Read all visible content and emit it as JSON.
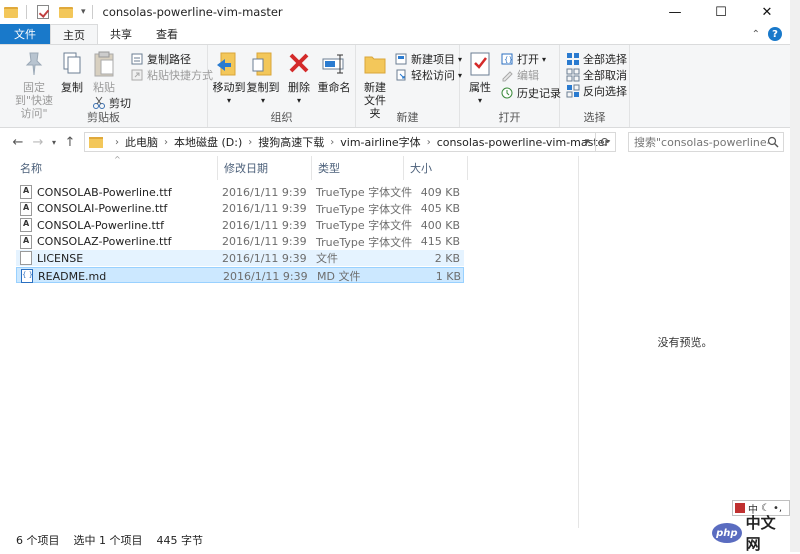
{
  "window": {
    "title": "consolas-powerline-vim-master",
    "minimize": "—",
    "maximize": "☐",
    "close": "✕"
  },
  "tabs": {
    "file": "文件",
    "home": "主页",
    "share": "共享",
    "view": "查看"
  },
  "ribbon": {
    "clipboard": {
      "label": "剪贴板",
      "pin": "固定到\"快速访问\"",
      "copy": "复制",
      "paste": "粘贴",
      "copy_path": "复制路径",
      "paste_shortcut": "粘贴快捷方式",
      "cut": "剪切"
    },
    "organize": {
      "label": "组织",
      "move_to": "移动到",
      "copy_to": "复制到",
      "delete": "删除",
      "rename": "重命名"
    },
    "new": {
      "label": "新建",
      "new_folder": "新建\n文件夹",
      "new_item": "新建项目",
      "easy_access": "轻松访问"
    },
    "open": {
      "label": "打开",
      "properties": "属性",
      "open": "打开",
      "edit": "编辑",
      "history": "历史记录"
    },
    "select": {
      "label": "选择",
      "select_all": "全部选择",
      "select_none": "全部取消",
      "invert": "反向选择"
    }
  },
  "address": {
    "crumbs": [
      "此电脑",
      "本地磁盘 (D:)",
      "搜狗高速下载",
      "vim-airline字体",
      "consolas-powerline-vim-master"
    ],
    "search_placeholder": "搜索\"consolas-powerline-vi...\""
  },
  "columns": {
    "name": "名称",
    "modified": "修改日期",
    "type": "类型",
    "size": "大小"
  },
  "files": [
    {
      "name": "CONSOLAB-Powerline.ttf",
      "modified": "2016/1/11 9:39",
      "type": "TrueType 字体文件",
      "size": "409 KB",
      "icon": "ttf"
    },
    {
      "name": "CONSOLAI-Powerline.ttf",
      "modified": "2016/1/11 9:39",
      "type": "TrueType 字体文件",
      "size": "405 KB",
      "icon": "ttf"
    },
    {
      "name": "CONSOLA-Powerline.ttf",
      "modified": "2016/1/11 9:39",
      "type": "TrueType 字体文件",
      "size": "400 KB",
      "icon": "ttf"
    },
    {
      "name": "CONSOLAZ-Powerline.ttf",
      "modified": "2016/1/11 9:39",
      "type": "TrueType 字体文件",
      "size": "415 KB",
      "icon": "ttf"
    },
    {
      "name": "LICENSE",
      "modified": "2016/1/11 9:39",
      "type": "文件",
      "size": "2 KB",
      "icon": "file"
    },
    {
      "name": "README.md",
      "modified": "2016/1/11 9:39",
      "type": "MD 文件",
      "size": "1 KB",
      "icon": "md"
    }
  ],
  "preview": {
    "empty": "没有预览。"
  },
  "status": {
    "count": "6 个项目",
    "selected": "选中 1 个项目",
    "selected_size": "445 字节"
  },
  "ime": {
    "mode": "中"
  },
  "watermark": {
    "logo": "php",
    "text": "中文网"
  },
  "colors": {
    "accent": "#1979ca",
    "selection": "#cce8ff",
    "selection_border": "#99d1ff"
  }
}
